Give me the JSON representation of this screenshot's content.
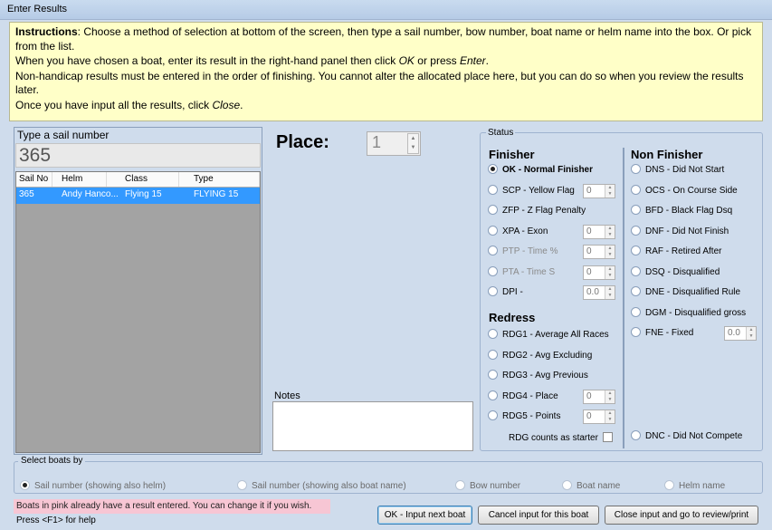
{
  "window": {
    "title": "Enter Results"
  },
  "instructions": {
    "line1_bold": "Instructions",
    "line1_rest": ": Choose a method of selection at bottom of the screen, then type a sail number, bow number, boat name or helm name into the box. Or pick from the list.",
    "line2_a": "When you have chosen a boat, enter its result in the right-hand panel then click ",
    "line2_ok": "OK",
    "line2_b": " or press ",
    "line2_enter": "Enter",
    "line2_c": ".",
    "line3": "Non-handicap results must be entered in the order of finishing. You cannot alter the allocated place here, but you can do so when you review the results later.",
    "line4_a": "Once you have input all the results, click ",
    "line4_close": "Close",
    "line4_b": "."
  },
  "search": {
    "label": "Type a sail number",
    "value": "365"
  },
  "grid": {
    "columns": [
      "Sail No",
      "Helm",
      "Class",
      "Type"
    ],
    "rows": [
      {
        "sail_no": "365",
        "helm": "Andy Hanco...",
        "class": "Flying 15",
        "type": "FLYING 15"
      }
    ]
  },
  "place": {
    "label": "Place:",
    "value": "1"
  },
  "notes": {
    "label": "Notes",
    "value": ""
  },
  "status": {
    "legend": "Status",
    "finisher_heading": "Finisher",
    "redress_heading": "Redress",
    "non_finisher_heading": "Non Finisher",
    "finisher": [
      {
        "label": "OK - Normal Finisher",
        "selected": true,
        "disabled": false,
        "value": null
      },
      {
        "label": "SCP - Yellow Flag",
        "selected": false,
        "disabled": false,
        "value": "0"
      },
      {
        "label": "ZFP - Z Flag Penalty",
        "selected": false,
        "disabled": false,
        "value": null
      },
      {
        "label": "XPA - Exon",
        "selected": false,
        "disabled": false,
        "value": "0"
      },
      {
        "label": "PTP - Time %",
        "selected": false,
        "disabled": true,
        "value": "0"
      },
      {
        "label": "PTA - Time S",
        "selected": false,
        "disabled": true,
        "value": "0"
      },
      {
        "label": "DPI -",
        "selected": false,
        "disabled": false,
        "value": "0.0"
      }
    ],
    "redress": [
      {
        "label": "RDG1 - Average All Races",
        "value": null
      },
      {
        "label": "RDG2 - Avg Excluding",
        "value": null
      },
      {
        "label": "RDG3 - Avg Previous",
        "value": null
      },
      {
        "label": "RDG4 - Place",
        "value": "0"
      },
      {
        "label": "RDG5 - Points",
        "value": "0"
      }
    ],
    "rdg_starter_label": "RDG counts as starter",
    "non_finisher": [
      {
        "label": "DNS - Did Not Start",
        "value": null
      },
      {
        "label": "OCS - On Course Side",
        "value": null
      },
      {
        "label": "BFD - Black Flag Dsq",
        "value": null
      },
      {
        "label": "DNF - Did Not Finish",
        "value": null
      },
      {
        "label": "RAF - Retired After",
        "value": null
      },
      {
        "label": "DSQ - Disqualified",
        "value": null
      },
      {
        "label": "DNE - Disqualified Rule",
        "value": null
      },
      {
        "label": "DGM - Disqualified gross",
        "value": null
      },
      {
        "label": "FNE - Fixed",
        "value": "0.0"
      }
    ],
    "dnc_label": "DNC - Did Not Compete"
  },
  "select_by": {
    "legend": "Select boats by",
    "options": [
      "Sail number (showing also helm)",
      "Sail number (showing also boat name)",
      "Bow number",
      "Boat name",
      "Helm name"
    ],
    "selected_index": 0
  },
  "footer": {
    "pink_note": "Boats in pink already have a result entered.  You can change it if you wish.",
    "help": "Press <F1> for help",
    "ok_button": "OK - Input next boat",
    "cancel_button": "Cancel input for this boat",
    "close_button": "Close input and go to review/print"
  }
}
